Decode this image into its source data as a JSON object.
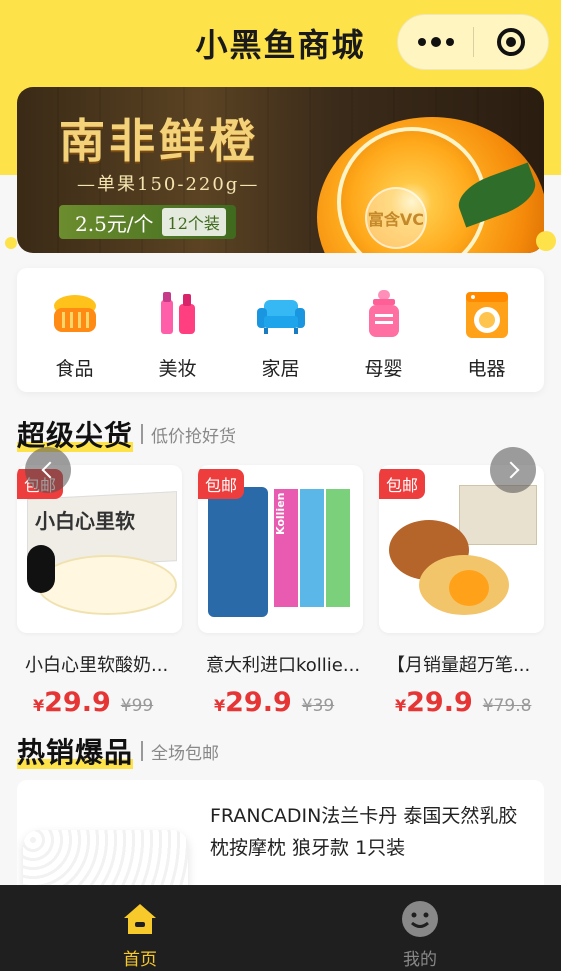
{
  "header": {
    "title": "小黑鱼商城"
  },
  "banner": {
    "title": "南非鲜橙",
    "subtitle": "—单果150-220g—",
    "price": "2.5元/个",
    "pack": "12个装",
    "seal": "富含VC"
  },
  "categories": [
    {
      "label": "食品",
      "icon": "bread-basket-icon"
    },
    {
      "label": "美妆",
      "icon": "cosmetics-icon"
    },
    {
      "label": "家居",
      "icon": "sofa-icon"
    },
    {
      "label": "母婴",
      "icon": "baby-bottle-icon"
    },
    {
      "label": "电器",
      "icon": "washing-machine-icon"
    }
  ],
  "sections": {
    "super": {
      "title": "超级尖货",
      "subtitle": "低价抢好货"
    },
    "hot": {
      "title": "热销爆品",
      "subtitle": "全场包邮"
    }
  },
  "products": [
    {
      "tag": "包邮",
      "name": "小白心里软酸奶...",
      "currency": "¥",
      "price": "29.9",
      "original": "¥99",
      "img_text": "小白心里软"
    },
    {
      "tag": "包邮",
      "name": "意大利进口kollie...",
      "currency": "¥",
      "price": "29.9",
      "original": "¥39",
      "img_text": "Kollien"
    },
    {
      "tag": "包邮",
      "name": "【月销量超万笔...",
      "currency": "¥",
      "price": "29.9",
      "original": "¥79.8",
      "img_text": ""
    }
  ],
  "hot_item": {
    "title": "FRANCADIN法兰卡丹 泰国天然乳胶枕按摩枕 狼牙款 1只装"
  },
  "tabbar": [
    {
      "label": "首页",
      "icon": "home-icon",
      "active": true
    },
    {
      "label": "我的",
      "icon": "smiley-user-icon",
      "active": false
    }
  ],
  "colors": {
    "brand_yellow": "#fde24a",
    "price_red": "#e63535",
    "tag_red": "#ee3d3d",
    "tabbar": "#1f1f1f"
  }
}
